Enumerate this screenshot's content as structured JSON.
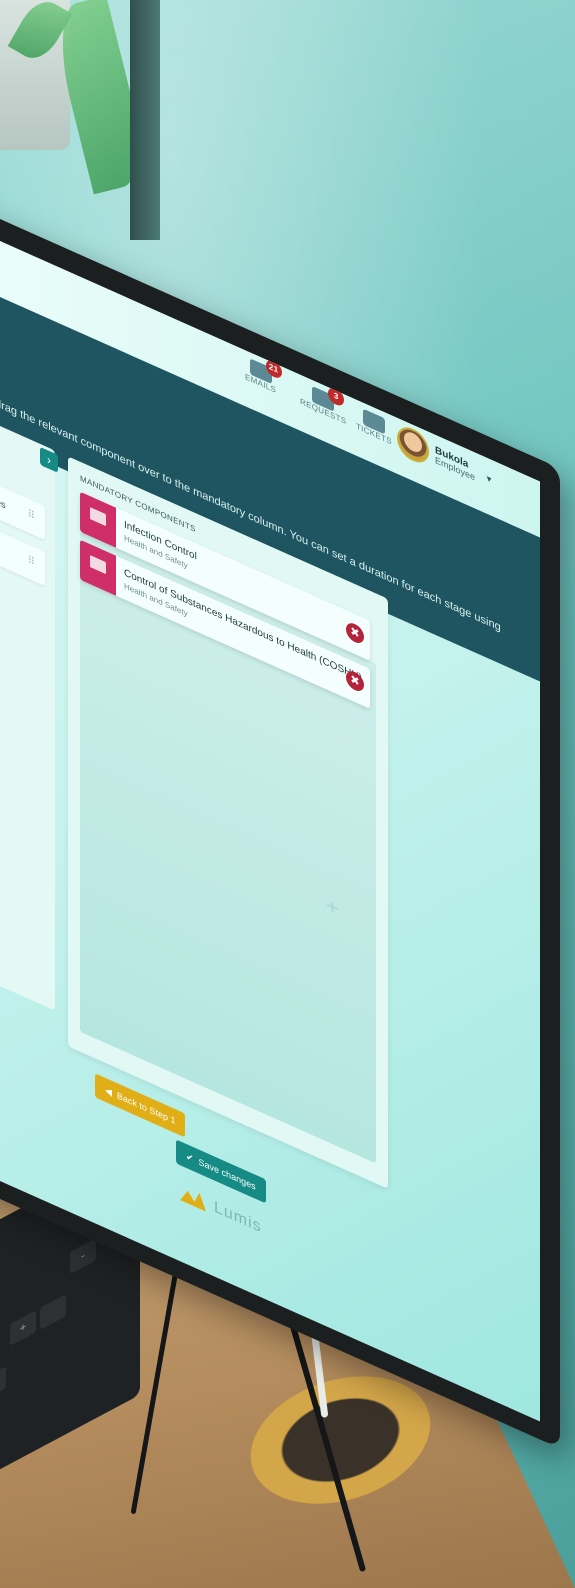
{
  "header": {
    "instruction": "drag the relevant component over to the mandatory column. You can set a duration for each stage using",
    "nav": [
      {
        "label": "EMAILS",
        "badge": "21",
        "icon": "envelope-icon"
      },
      {
        "label": "REQUESTS",
        "badge": "3",
        "icon": "chat-icon"
      },
      {
        "label": "TICKETS",
        "badge": "",
        "icon": "ticket-icon"
      }
    ],
    "user": {
      "name": "Bukola",
      "role": "Employee"
    }
  },
  "left_panel": {
    "items": [
      {
        "label": "les"
      },
      {
        "label": ""
      }
    ]
  },
  "mandatory": {
    "title": "MANDATORY COMPONENTS",
    "components": [
      {
        "title": "Infection Control",
        "category": "Health and Safety"
      },
      {
        "title": "Control of Substances Hazardous to Health (COSHH)",
        "category": "Health and Safety"
      }
    ]
  },
  "actions": {
    "back_label": "Back to Step 1",
    "save_label": "Save changes"
  },
  "brand": {
    "name": "Lumis",
    "accent": "#e0ae17",
    "primary": "#168b86",
    "header_bg": "#1e5560",
    "icon_bg": "#cf2f66"
  },
  "keyboard": {
    "keys": [
      "-",
      "+"
    ]
  }
}
